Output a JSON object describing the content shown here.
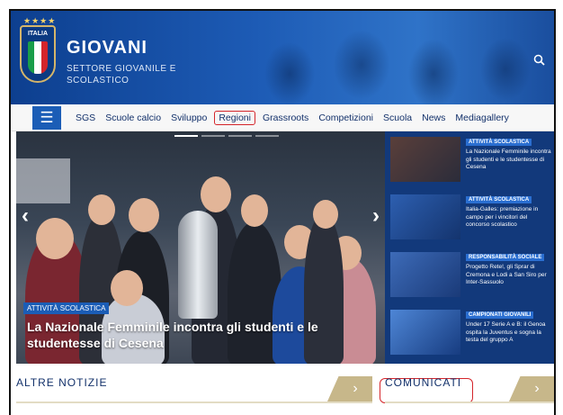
{
  "header": {
    "shield_text": "ITALIA",
    "title": "GIOVANI",
    "subtitle": "SETTORE GIOVANILE E SCOLASTICO",
    "search_icon": "search-icon"
  },
  "nav": {
    "menu_icon": "hamburger-icon",
    "items": [
      {
        "label": "SGS"
      },
      {
        "label": "Scuole calcio"
      },
      {
        "label": "Sviluppo"
      },
      {
        "label": "Regioni",
        "highlighted": true
      },
      {
        "label": "Grassroots"
      },
      {
        "label": "Competizioni"
      },
      {
        "label": "Scuola"
      },
      {
        "label": "News"
      },
      {
        "label": "Mediagallery"
      }
    ]
  },
  "hero": {
    "tag": "ATTIVITÀ SCOLASTICA",
    "caption": "La Nazionale Femminile incontra gli studenti e le studentesse di Cesena",
    "prev_arrow": "‹",
    "next_arrow": "›",
    "slides": 4,
    "active_slide": 1
  },
  "side_news": [
    {
      "tag": "ATTIVITÀ SCOLASTICA",
      "text": "La Nazionale Femminile incontra gli studenti e le studentesse di Cesena"
    },
    {
      "tag": "ATTIVITÀ SCOLASTICA",
      "text": "Italia-Galles: premiazione in campo per i vincitori del concorso scolastico"
    },
    {
      "tag": "RESPONSABILITÀ SOCIALE",
      "text": "Progetto Rete!, gli Sprar di Cremona e Lodi a San Siro per Inter-Sassuolo"
    },
    {
      "tag": "CAMPIONATI GIOVANILI",
      "text": "Under 17 Serie A e B: il Genoa ospita la Juventus e sogna la testa del gruppo A"
    }
  ],
  "bottom": {
    "altre_notizie": "ALTRE NOTIZIE",
    "comunicati": "COMUNICATI",
    "chevron": "›"
  },
  "colors": {
    "brand_blue": "#1b5db6",
    "navy": "#12397b",
    "gold": "#c7b78a",
    "highlight_red": "#d4252b"
  }
}
